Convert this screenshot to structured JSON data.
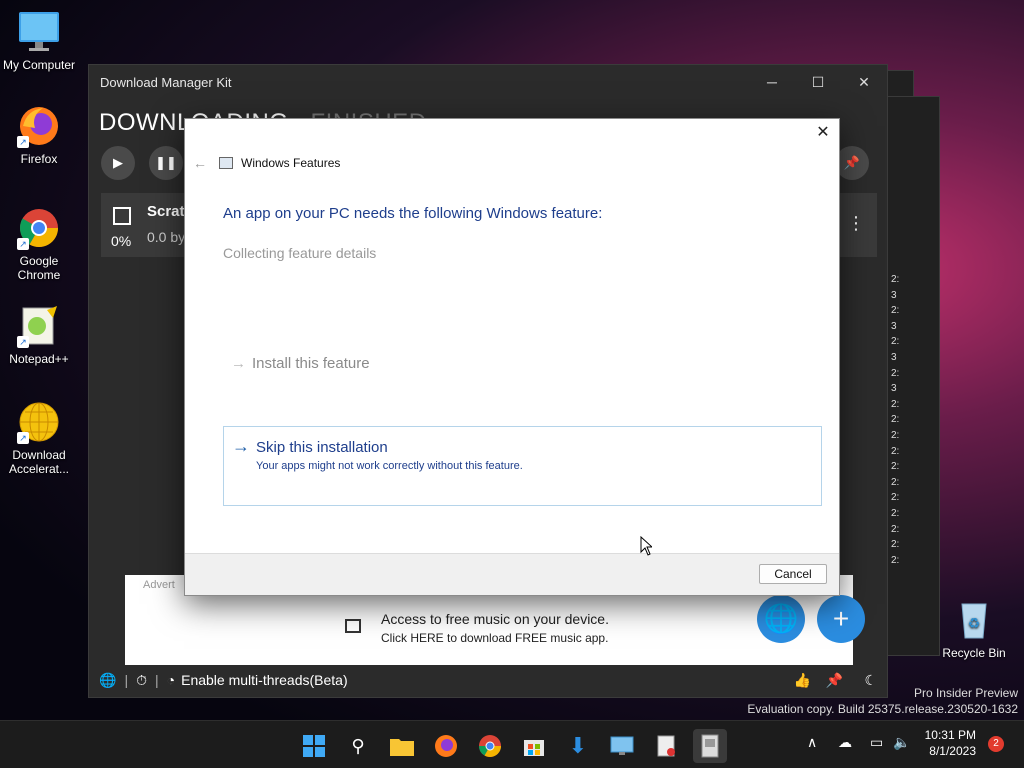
{
  "desktop": {
    "icons": [
      {
        "label": "My Computer"
      },
      {
        "label": "Firefox"
      },
      {
        "label": "Google Chrome"
      },
      {
        "label": "Notepad++"
      },
      {
        "label": "Download Accelerat..."
      },
      {
        "label": "Recycle Bin"
      }
    ],
    "watermark_line1": "Pro Insider Preview",
    "watermark_line2": "Evaluation copy. Build 25375.release.230520-1632"
  },
  "app": {
    "title": "Download Manager Kit",
    "tab_downloading": "DOWNLOADING",
    "tab_finished": "FINISHED",
    "item_name": "Scratc",
    "item_percent": "0%",
    "item_size": "0.0 by",
    "ad_label": "Advert",
    "ad_title": "Access to free music on your device.",
    "ad_subtitle": "Click HERE to download FREE music app.",
    "status_text": "Enable multi-threads(Beta)"
  },
  "dialog": {
    "title": "Windows Features",
    "heading": "An app on your PC needs the following Windows feature:",
    "collecting": "Collecting feature details",
    "install_option": "Install this feature",
    "skip_title": "Skip this installation",
    "skip_subtitle": "Your apps might not work correctly without this feature.",
    "cancel_label": "Cancel"
  },
  "taskbar": {
    "time": "10:31 PM",
    "date": "8/1/2023",
    "notification_count": "2"
  }
}
